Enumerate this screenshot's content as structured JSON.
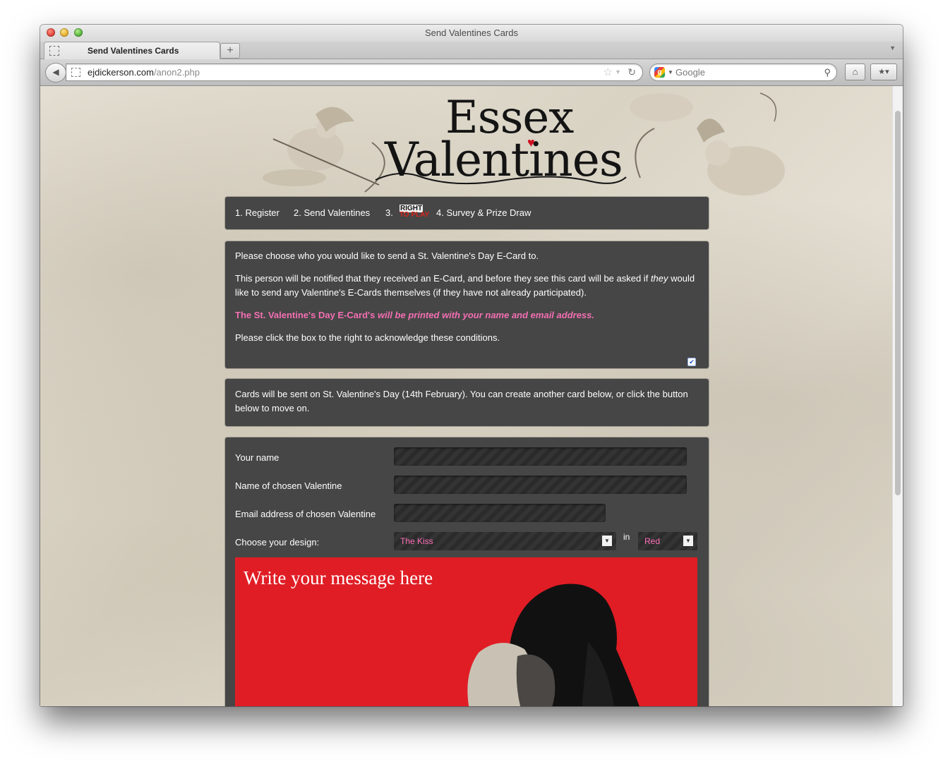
{
  "window": {
    "title": "Send Valentines Cards"
  },
  "tab": {
    "title": "Send Valentines Cards",
    "new_tab": "+"
  },
  "toolbar": {
    "url_host": "ejdickerson.com",
    "url_path": "/anon2.php",
    "search_placeholder": "Google"
  },
  "logo": {
    "line1": "Essex",
    "line2": "Valentines"
  },
  "steps": [
    {
      "label": "1. Register"
    },
    {
      "label": "2. Send Valentines"
    },
    {
      "label": "3."
    },
    {
      "label": "4. Survey & Prize Draw"
    }
  ],
  "sponsor_logo": {
    "line1": "RIGHT",
    "line2": "TO PLAY"
  },
  "notice": {
    "p1": "Please choose who you would like to send a St. Valentine's Day E-Card to.",
    "p2a": "This person will be notified that they received an E-Card, and before they see this card will be asked if ",
    "p2_em": "they",
    "p2b": " would like to send any Valentine's E-Cards themselves (if they have not already participated).",
    "p3a": "The St. Valentine's Day E-Card's ",
    "p3b": "will be printed with your name and email address.",
    "p4": "Please click the box to the right to acknowledge these conditions.",
    "acknowledged": true
  },
  "info": {
    "text": "Cards will be sent on St. Valentine's Day (14th February). You can create another card below, or click the button below to move on."
  },
  "form": {
    "your_name_label": "Your name",
    "your_name_value": "",
    "valentine_name_label": "Name of chosen Valentine",
    "valentine_name_value": "",
    "valentine_email_label": "Email address of chosen Valentine",
    "valentine_email_value": "",
    "design_label": "Choose your design:",
    "design_value": "The Kiss",
    "in_label": "in",
    "color_value": "Red"
  },
  "card": {
    "message_placeholder": "Write your message here",
    "background_color": "#e01d25"
  },
  "colors": {
    "panel": "#464646",
    "accent_pink": "#f46fb3"
  }
}
